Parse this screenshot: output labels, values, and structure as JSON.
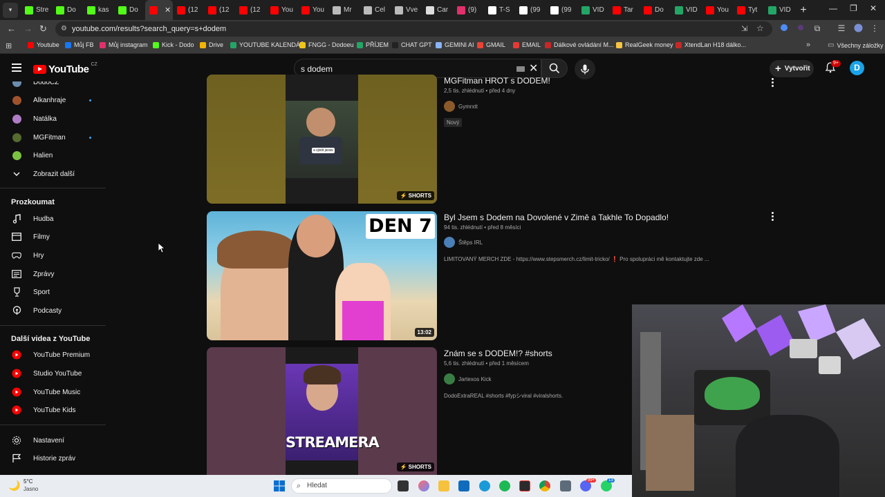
{
  "browser": {
    "tabs": [
      {
        "label": "Stre",
        "icon": "kick-icon",
        "color": "#53fc18"
      },
      {
        "label": "Do",
        "icon": "kick-icon",
        "color": "#53fc18"
      },
      {
        "label": "kas",
        "icon": "kick-icon",
        "color": "#53fc18"
      },
      {
        "label": "Do",
        "icon": "kick-icon",
        "color": "#53fc18"
      },
      {
        "label": "",
        "icon": "youtube-icon",
        "color": "#ff0000",
        "active": true
      },
      {
        "label": "(12",
        "icon": "youtube-icon",
        "color": "#ff0000"
      },
      {
        "label": "(12",
        "icon": "youtube-icon",
        "color": "#ff0000"
      },
      {
        "label": "(12",
        "icon": "youtube-icon",
        "color": "#ff0000"
      },
      {
        "label": "You",
        "icon": "youtube-icon",
        "color": "#ff0000"
      },
      {
        "label": "You",
        "icon": "youtube-icon",
        "color": "#ff0000"
      },
      {
        "label": "Mr",
        "icon": "wave-icon",
        "color": "#bbbbbb"
      },
      {
        "label": "Cel",
        "icon": "wave-icon",
        "color": "#bbbbbb"
      },
      {
        "label": "Vve",
        "icon": "wave-icon",
        "color": "#bbbbbb"
      },
      {
        "label": "Car",
        "icon": "cc-icon",
        "color": "#dddddd"
      },
      {
        "label": "(9)",
        "icon": "instagram-icon",
        "color": "#e1306c"
      },
      {
        "label": "T-S",
        "icon": "t-icon",
        "color": "#ffffff"
      },
      {
        "label": "(99",
        "icon": "tiktok-icon",
        "color": "#ffffff"
      },
      {
        "label": "(99",
        "icon": "tiktok-icon",
        "color": "#ffffff"
      },
      {
        "label": "VID",
        "icon": "sheets-icon",
        "color": "#23a566"
      },
      {
        "label": "Tar",
        "icon": "youtube-icon",
        "color": "#ff0000"
      },
      {
        "label": "Do",
        "icon": "youtube-icon",
        "color": "#ff0000"
      },
      {
        "label": "VID",
        "icon": "sheets-icon",
        "color": "#23a566"
      },
      {
        "label": "You",
        "icon": "youtube-icon",
        "color": "#ff0000"
      },
      {
        "label": "Tyt",
        "icon": "youtube-icon",
        "color": "#ff0000"
      },
      {
        "label": "VID",
        "icon": "sheets-icon",
        "color": "#23a566"
      }
    ],
    "new_tab": "+",
    "url": "youtube.com/results?search_query=s+dodem",
    "bookmarks": [
      {
        "label": "Youtube",
        "color": "#ff0000"
      },
      {
        "label": "Můj FB",
        "color": "#1877f2"
      },
      {
        "label": "Můj instagram",
        "color": "#e1306c"
      },
      {
        "label": "Kick - Dodo",
        "color": "#53fc18"
      },
      {
        "label": "Drive",
        "color": "#f4b400"
      },
      {
        "label": "YOUTUBE KALENDÁŘ",
        "color": "#23a566"
      },
      {
        "label": "FNGG - Dodoeu",
        "color": "#f0c419"
      },
      {
        "label": "PŘÍJEM",
        "color": "#23a566"
      },
      {
        "label": "CHAT GPT",
        "color": "#222222"
      },
      {
        "label": "GEMINI AI",
        "color": "#8ab4f8"
      },
      {
        "label": "GMAIL",
        "color": "#ea4335"
      },
      {
        "label": "EMAIL",
        "color": "#e53935"
      },
      {
        "label": "Dálkové ovládání M...",
        "color": "#c62828"
      },
      {
        "label": "RealGeek money",
        "color": "#f6c342"
      },
      {
        "label": "XtendLan H18 dálko...",
        "color": "#c62828"
      }
    ],
    "all_bookmarks": "Všechny záložky"
  },
  "youtube": {
    "logo_text": "YouTube",
    "logo_region": "CZ",
    "search_query": "s dodem",
    "create_label": "Vytvořit",
    "notifications_badge": "9+",
    "avatar_letter": "D",
    "brand_red": "#ff0000"
  },
  "sidebar": {
    "subscriptions": [
      {
        "label": "DodoCZ",
        "avatar_color": "#6a8caf",
        "dot": false
      },
      {
        "label": "Alkanhraje",
        "avatar_color": "#a0522d",
        "dot": true
      },
      {
        "label": "Natálka",
        "avatar_color": "#b07cc6",
        "dot": false
      },
      {
        "label": "MGFitman",
        "avatar_color": "#556b2f",
        "dot": true
      },
      {
        "label": "Halien",
        "avatar_color": "#7cc242",
        "dot": false
      }
    ],
    "show_more": "Zobrazit další",
    "explore_title": "Prozkoumat",
    "explore": [
      {
        "label": "Hudba",
        "icon": "music-note-icon"
      },
      {
        "label": "Filmy",
        "icon": "film-icon"
      },
      {
        "label": "Hry",
        "icon": "gamepad-icon"
      },
      {
        "label": "Zprávy",
        "icon": "newspaper-icon"
      },
      {
        "label": "Sport",
        "icon": "trophy-icon"
      },
      {
        "label": "Podcasty",
        "icon": "podcast-icon"
      }
    ],
    "more_title": "Další videa z YouTube",
    "more": [
      {
        "label": "YouTube Premium"
      },
      {
        "label": "Studio YouTube"
      },
      {
        "label": "YouTube Music"
      },
      {
        "label": "YouTube Kids"
      }
    ],
    "settings": [
      {
        "label": "Nastavení",
        "icon": "gear-icon"
      },
      {
        "label": "Historie zpráv",
        "icon": "flag-icon"
      }
    ]
  },
  "results": [
    {
      "title": "MGFitman HROT s DODEM!",
      "meta": "2,5 tis. zhlédnutí • před 4 dny",
      "channel": "Gymrxtt",
      "channel_color": "#8b5a2b",
      "chip": "Nový",
      "badge": "SHORTS",
      "description": ""
    },
    {
      "title": "Byl Jsem s Dodem na Dovolené v Zimě a Takhle To Dopadlo!",
      "meta": "94 tis. zhlédnutí • před 8 měsíci",
      "channel": "Štěps IRL",
      "channel_color": "#4b7fb8",
      "badge": "13:02",
      "thumb_text": "DEN 7",
      "description": "LIMITOVANÝ MERCH ZDE - https://www.stepsmerch.cz/limit-tricko/ ❗ Pro spolupráci mě kontaktujte zde ..."
    },
    {
      "title": "Znám se s DODEM!? #shorts",
      "meta": "5,6 tis. zhlédnutí • před 1 měsícem",
      "channel": "Jartexos Kick",
      "channel_color": "#3a7d44",
      "badge": "SHORTS",
      "thumb_text": "STREAMERA",
      "description": "DodoExtraREAL #shorts #fypシviral #viralshorts."
    }
  ],
  "thumb_caption": "a zjistit jaraw",
  "taskbar": {
    "weather_temp": "5°C",
    "weather_desc": "Jasno",
    "search_placeholder": "Hledat",
    "discord_badge": "99+",
    "whatsapp_badge": "13"
  }
}
